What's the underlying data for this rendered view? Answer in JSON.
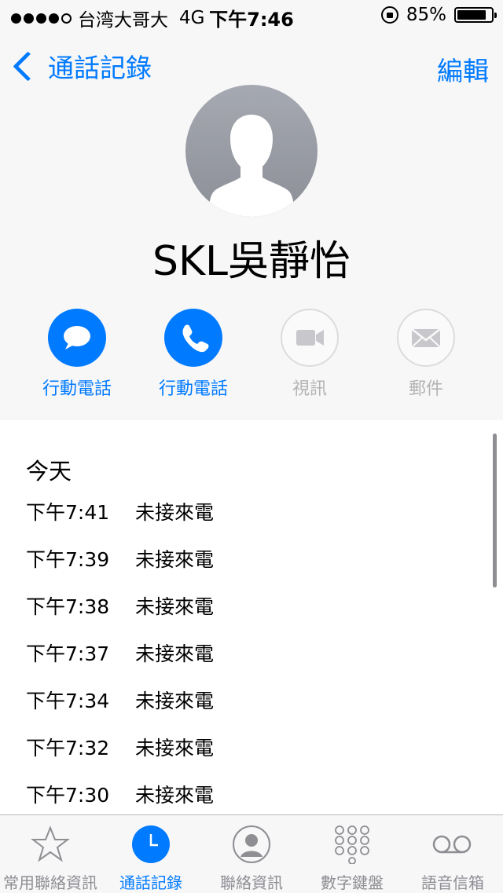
{
  "status": {
    "carrier": "台湾大哥大",
    "network": "4G",
    "time": "下午7:46",
    "battery": "85%",
    "battery_level": 0.85,
    "signal_bars": 4
  },
  "nav": {
    "back_label": "通話記錄",
    "edit_label": "編輯"
  },
  "contact": {
    "name": "SKL吳靜怡"
  },
  "actions": [
    {
      "label": "行動電話",
      "icon": "message-icon",
      "enabled": true
    },
    {
      "label": "行動電話",
      "icon": "phone-icon",
      "enabled": true
    },
    {
      "label": "視訊",
      "icon": "video-icon",
      "enabled": false
    },
    {
      "label": "郵件",
      "icon": "mail-icon",
      "enabled": false
    }
  ],
  "history": {
    "section": "今天",
    "rows": [
      {
        "time": "下午7:41",
        "status": "未接來電"
      },
      {
        "time": "下午7:39",
        "status": "未接來電"
      },
      {
        "time": "下午7:38",
        "status": "未接來電"
      },
      {
        "time": "下午7:37",
        "status": "未接來電"
      },
      {
        "time": "下午7:34",
        "status": "未接來電"
      },
      {
        "time": "下午7:32",
        "status": "未接來電"
      },
      {
        "time": "下午7:30",
        "status": "未接來電"
      }
    ]
  },
  "tabs": [
    {
      "label": "常用聯絡資訊",
      "icon": "star-icon",
      "active": false
    },
    {
      "label": "通話記錄",
      "icon": "clock-icon",
      "active": true
    },
    {
      "label": "聯絡資訊",
      "icon": "contact-icon",
      "active": false
    },
    {
      "label": "數字鍵盤",
      "icon": "keypad-icon",
      "active": false
    },
    {
      "label": "語音信箱",
      "icon": "voicemail-icon",
      "active": false
    }
  ],
  "colors": {
    "accent": "#007aff",
    "disabled": "#b3b3b3",
    "tab_inactive": "#8e8e93"
  }
}
